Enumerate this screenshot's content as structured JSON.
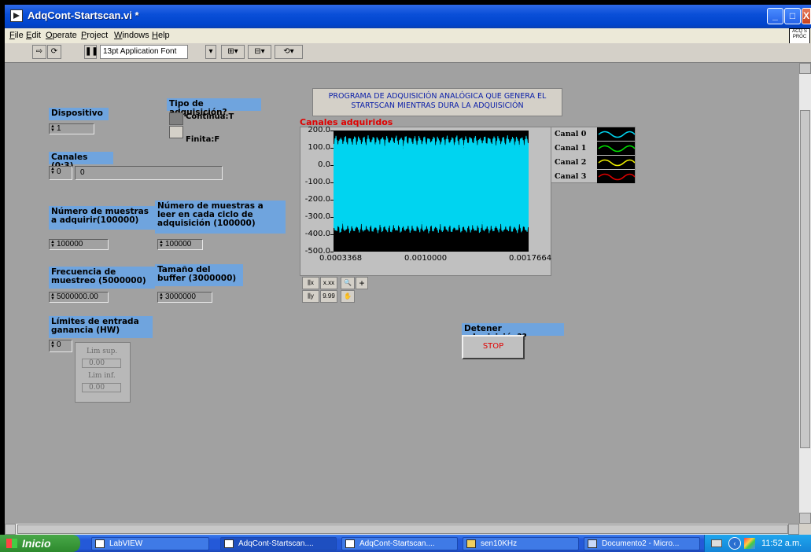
{
  "window": {
    "title": "AdqCont-Startscan.vi *",
    "buttons": {
      "minimize": "_",
      "maximize": "□",
      "close": "X"
    }
  },
  "menu": [
    {
      "label": "File",
      "key": "F",
      "rest": "ile"
    },
    {
      "label": "Edit",
      "key": "E",
      "rest": "dit"
    },
    {
      "label": "Operate",
      "key": "O",
      "rest": "perate"
    },
    {
      "label": "Project",
      "key": "P",
      "rest": "roject"
    },
    {
      "label": "Windows",
      "key": "W",
      "rest": "indows"
    },
    {
      "label": "Help",
      "key": "H",
      "rest": "elp"
    }
  ],
  "toolbar": {
    "font": "13pt Application Font",
    "palette_label": "ACQ S PROC"
  },
  "panel": {
    "description": "PROGRAMA DE ADQUISICIÓN ANALÓGICA QUE GENERA EL STARTSCAN MIENTRAS DURA LA ADQUISICIÓN",
    "dispositivo": {
      "label": "Dispositivo",
      "value": "1"
    },
    "tipo": {
      "label": "Tipo de adquisición?",
      "on_text": "Continua:T",
      "off_text": "Finita:F"
    },
    "canales": {
      "label": "Canales (0:3)",
      "index": "0",
      "value": "0"
    },
    "num_muestras": {
      "label": "Número de muestras a adquirir(100000)",
      "value": "100000"
    },
    "num_leer": {
      "label": "Número de muestras a leer en cada ciclo de adquisición (100000)",
      "value": "100000"
    },
    "frecuencia": {
      "label": "Frecuencia de muestreo (5000000)",
      "value": "5000000.00"
    },
    "buffer": {
      "label": "Tamaño del  buffer (3000000)",
      "value": "3000000"
    },
    "limites": {
      "label": "Límites de entrada ganancia (HW)",
      "index": "0",
      "sup_label": "Lim sup.",
      "sup_value": "0.00",
      "inf_label": "Lim inf.",
      "inf_value": "0.00"
    },
    "detener": {
      "label": "Detener adquisición??",
      "button": "STOP"
    }
  },
  "chart_data": {
    "type": "line",
    "title": "Canales adquiridos",
    "yticks": [
      "200.0",
      "100.0",
      "0.0",
      "-100.0",
      "-200.0",
      "-300.0",
      "-400.0",
      "-500.0"
    ],
    "ylim": [
      -500,
      200
    ],
    "xticks": [
      "0.0003368",
      "0.0010000",
      "0.0017664"
    ],
    "xlim": [
      0.0003368,
      0.0017664
    ],
    "series": [
      {
        "name": "Canal 0",
        "color": "#00d4f0"
      },
      {
        "name": "Canal 1",
        "color": "#00e000"
      },
      {
        "name": "Canal 2",
        "color": "#f0f000"
      },
      {
        "name": "Canal 3",
        "color": "#e00000"
      }
    ],
    "band": {
      "upper_top": 150,
      "upper_peak": 100,
      "lower_bottom": -370,
      "lower_peak": -250,
      "cycles": 21
    }
  },
  "taskbar": {
    "start": "Inicio",
    "tasks": [
      "LabVIEW",
      "AdqCont-Startscan....",
      "AdqCont-Startscan....",
      "sen10KHz",
      "Documento2 - Micro..."
    ],
    "clock": "11:52 a.m."
  }
}
